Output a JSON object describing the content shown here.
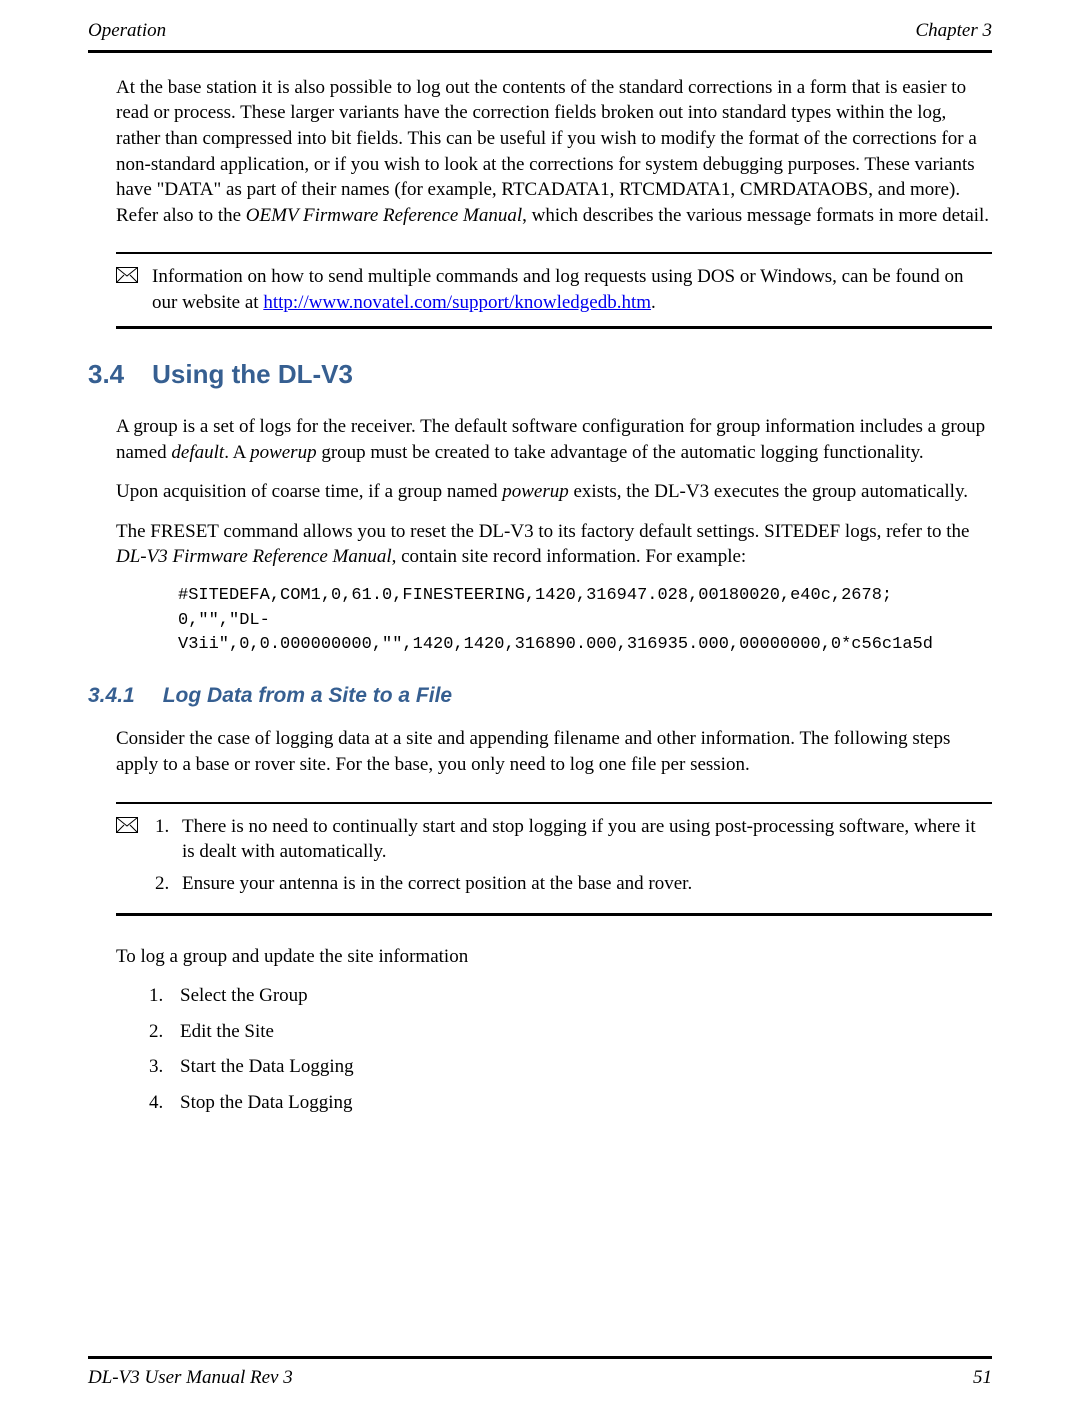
{
  "header": {
    "left": "Operation",
    "right": "Chapter 3"
  },
  "intro_para": {
    "pre": "At the base station it is also possible to log out the contents of the standard corrections in a form that is easier to read or process. These larger variants have the correction fields broken out into standard types within the log, rather than compressed into bit fields. This can be useful if you wish to modify the format of the corrections for a non-standard application, or if you wish to look at the corrections for system debugging purposes. These variants have \"DATA\" as part of their names (for example, RTCADATA1, RTCMDATA1, CMRDATAOBS, and more). Refer also to the ",
    "em": "OEMV Firmware Reference Manual",
    "post": ", which describes the various message formats in more detail."
  },
  "note1": {
    "pre": "Information on how to send multiple commands and log requests using DOS or Windows, can be found on our website at ",
    "link_text": "http://www.novatel.com/support/knowledgedb.htm",
    "post": "."
  },
  "section34": {
    "num": "3.4",
    "title": "Using the DL-V3"
  },
  "p34_1": {
    "a": "A group is a set of logs for the receiver. The default software configuration for group information includes a group named ",
    "em1": "default",
    "b": ". A ",
    "em2": "powerup",
    "c": " group must be created to take advantage of the automatic logging functionality."
  },
  "p34_2": {
    "a": "Upon acquisition of coarse time, if a group named ",
    "em": "powerup",
    "b": " exists, the DL-V3 executes the group automatically."
  },
  "p34_3": {
    "a": "The FRESET command allows you to reset the DL-V3 to its factory default settings. SITEDEF logs, refer to the ",
    "em": "DL-V3 Firmware Reference Manual",
    "b": ", contain site record information. For example:"
  },
  "code_block": "#SITEDEFA,COM1,0,61.0,FINESTEERING,1420,316947.028,00180020,e40c,2678;\n0,\"\",\"DL-\nV3ii\",0,0.000000000,\"\",1420,1420,316890.000,316935.000,00000000,0*c56c1a5d",
  "section341": {
    "num": "3.4.1",
    "title": "Log Data from a Site to a File"
  },
  "p341_1": "Consider the case of logging data at a site and appending filename and other information. The following steps apply to a base or rover site. For the base, you only need to log one file per session.",
  "note2": {
    "item1": "There is no need to continually start and stop logging if you are using post-processing software, where it is dealt with automatically.",
    "item2": "Ensure your antenna is in the correct position at the base and rover."
  },
  "p341_2": "To log a group and update the site information",
  "steps": [
    "Select the Group",
    "Edit the Site",
    "Start the Data Logging",
    "Stop the Data Logging"
  ],
  "footer": {
    "left": "DL-V3 User Manual Rev 3",
    "right": "51"
  }
}
